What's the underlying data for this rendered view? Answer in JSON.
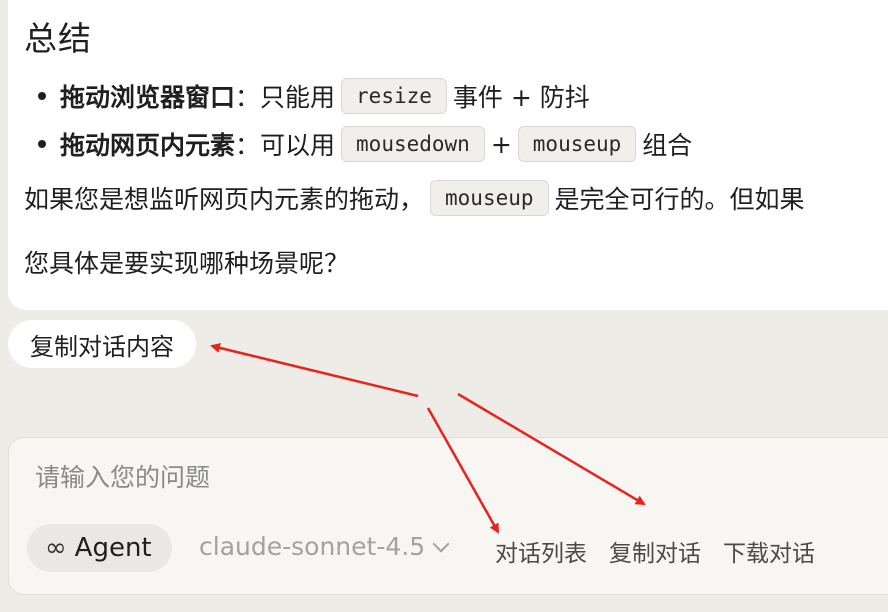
{
  "message": {
    "title": "总结",
    "bullets": [
      {
        "bold": "拖动浏览器窗口",
        "sep": "：只能用",
        "code": "resize",
        "after": "事件 + 防抖"
      },
      {
        "bold": "拖动网页内元素",
        "sep": "：可以用",
        "code1": "mousedown",
        "plus": "+",
        "code2": "mouseup",
        "after": "组合"
      }
    ],
    "para1": {
      "before": "如果您是想监听网页内元素的拖动，",
      "code": "mouseup",
      "after": "是完全可行的。但如果"
    },
    "para2": "您具体是要实现哪种场景呢？"
  },
  "copy_chip": "复制对话内容",
  "composer": {
    "placeholder": "请输入您的问题",
    "agent_icon": "infinity-icon",
    "agent_label": "Agent",
    "model": "claude-sonnet-4.5",
    "actions": [
      "对话列表",
      "复制对话",
      "下载对话"
    ]
  },
  "colors": {
    "annotation_arrow": "#e8231b",
    "card": "#ffffff",
    "background": "#eeece7"
  }
}
